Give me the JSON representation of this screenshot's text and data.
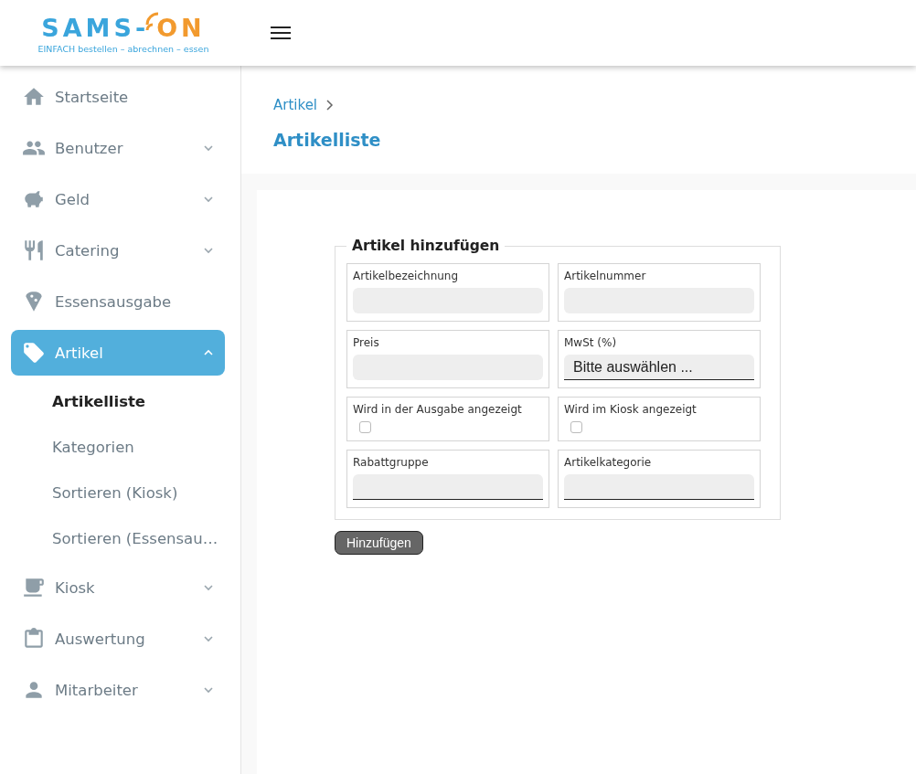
{
  "header": {
    "logo": {
      "part_1": "SAMS-",
      "part_2": "ON",
      "tagline": "EINFACH bestellen – abrechnen – essen"
    }
  },
  "sidebar": {
    "items": [
      {
        "label": "Startseite",
        "kind": "home",
        "selected": false
      },
      {
        "label": "Benutzer",
        "kind": "users",
        "expanded": false,
        "selected": false
      },
      {
        "label": "Geld",
        "kind": "piggy",
        "expanded": false,
        "selected": false
      },
      {
        "label": "Catering",
        "kind": "cutlery",
        "expanded": false,
        "selected": false
      },
      {
        "label": "Essensausgabe",
        "kind": "pin",
        "selected": false
      },
      {
        "label": "Artikel",
        "kind": "tag",
        "expanded": true,
        "selected": true,
        "children": [
          {
            "label": "Artikelliste",
            "selected": true
          },
          {
            "label": "Kategorien",
            "selected": false
          },
          {
            "label": "Sortieren (Kiosk)",
            "selected": false
          },
          {
            "label": "Sortieren (Essensau…",
            "selected": false
          }
        ]
      },
      {
        "label": "Kiosk",
        "kind": "cup",
        "expanded": false,
        "selected": false
      },
      {
        "label": "Auswertung",
        "kind": "clipboard",
        "expanded": false,
        "selected": false
      },
      {
        "label": "Mitarbeiter",
        "kind": "person",
        "expanded": false,
        "selected": false
      }
    ]
  },
  "breadcrumb": [
    "Artikel"
  ],
  "page_title": "Artikelliste",
  "form": {
    "legend": "Artikel hinzufügen",
    "fields": [
      {
        "kind": "text",
        "label": "Artikelbezeichnung"
      },
      {
        "kind": "text",
        "label": "Artikelnummer"
      },
      {
        "kind": "text",
        "label": "Preis"
      },
      {
        "kind": "select",
        "label": "MwSt (%)",
        "value": "Bitte auswählen ..."
      },
      {
        "kind": "checkbox",
        "label": "Wird in der Ausgabe angezeigt",
        "checked": false
      },
      {
        "kind": "checkbox",
        "label": "Wird im Kiosk angezeigt",
        "checked": false
      },
      {
        "kind": "dropdown",
        "label": "Rabattgruppe"
      },
      {
        "kind": "dropdown",
        "label": "Artikelkategorie"
      }
    ],
    "submit": "Hinzufügen"
  }
}
